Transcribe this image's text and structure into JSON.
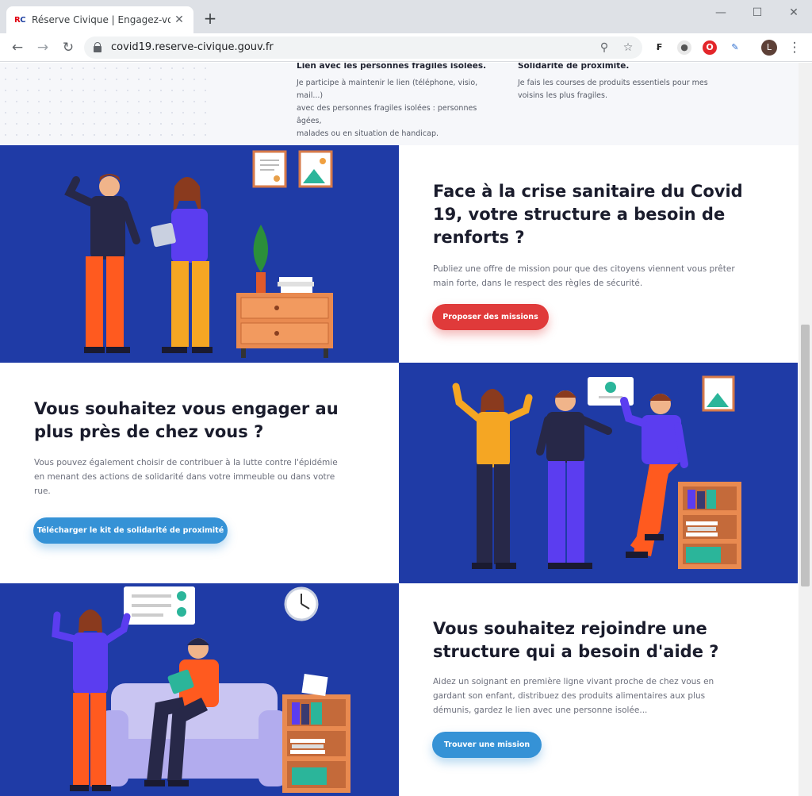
{
  "browser": {
    "favicon_text_a": "R",
    "favicon_text_b": "C",
    "tab_title": "Réserve Civique | Engagez-vous f",
    "url": "covid19.reserve-civique.gouv.fr",
    "avatar_letter": "L",
    "tab_close": "✕",
    "new_tab": "+"
  },
  "features": [
    {
      "title": "Lien avec les personnes fragiles isolées.",
      "lines": [
        "Je participe à maintenir le lien (téléphone, visio, mail...)",
        "avec des personnes fragiles isolées : personnes âgées,",
        "malades ou en situation de handicap."
      ]
    },
    {
      "title": "Solidarité de proximité.",
      "lines": [
        "Je fais les courses de produits essentiels pour mes",
        "voisins les plus fragiles."
      ]
    }
  ],
  "sections": [
    {
      "title_lines": [
        "Face à la crise sanitaire du Covid",
        "19, votre structure a besoin de",
        "renforts ?"
      ],
      "text_lines": [
        "Publiez une offre de mission pour que des citoyens viennent vous prêter",
        "main forte, dans le respect des règles de sécurité."
      ],
      "button": "Proposer des missions"
    },
    {
      "title_lines": [
        "Vous souhaitez vous engager au",
        "plus près de chez vous ?"
      ],
      "text_lines": [
        "Vous pouvez également choisir de contribuer à la lutte contre l'épidémie",
        "en menant des actions de solidarité dans votre immeuble ou dans votre",
        "rue."
      ],
      "button": "Télécharger le kit de solidarité de proximité"
    },
    {
      "title_lines": [
        "Vous souhaitez rejoindre une",
        "structure qui a besoin d'aide ?"
      ],
      "text_lines": [
        "Aidez un soignant en première ligne vivant proche de chez vous en",
        "gardant son enfant, distribuez des produits alimentaires aux plus",
        "démunis, gardez le lien avec une personne isolée..."
      ],
      "button": "Trouver une mission"
    }
  ],
  "colors": {
    "panel_blue": "#1f3ba6",
    "button_red": "#e03a3a",
    "button_blue": "#3592d6"
  }
}
